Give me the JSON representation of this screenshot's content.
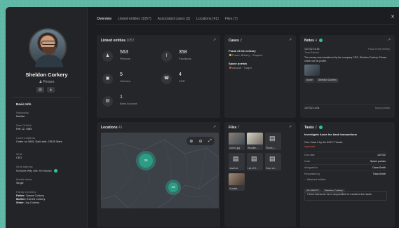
{
  "profile": {
    "name": "Sheldon Corkery",
    "type": "Person",
    "basic_info_title": "Basic Info",
    "fields": [
      {
        "k": "Nationality",
        "v": "Martian"
      },
      {
        "k": "Date Of Birth",
        "v": "Feb 12, 1985"
      },
      {
        "k": "Current address",
        "v": "Crater no 1840, Dark side, 29100 Mars"
      },
      {
        "k": "Work",
        "v": "CEO"
      },
      {
        "k": "Work Address",
        "v": "Kovacek Way 106, Tennessee"
      },
      {
        "k": "Marital status",
        "v": "Single"
      },
      {
        "k": "Family members",
        "v": ""
      }
    ],
    "family": [
      {
        "rel": "Father:",
        "name": "Tyrone Corkery"
      },
      {
        "rel": "Mother:",
        "name": "Everett Corkery"
      },
      {
        "rel": "Sister:",
        "name": "Joy Corkery"
      }
    ]
  },
  "tabs": [
    {
      "label": "Overview"
    },
    {
      "label": "Linked entities (1057)"
    },
    {
      "label": "Associated cases (2)"
    },
    {
      "label": "Locations (41)"
    },
    {
      "label": "Files (7)"
    }
  ],
  "linked": {
    "title": "Linked entities",
    "count": "1057",
    "stats": [
      {
        "num": "563",
        "label": "Persons",
        "icon": "person-icon",
        "glyph": "♟"
      },
      {
        "num": "358",
        "label": "Facebook",
        "icon": "facebook-icon",
        "glyph": "f"
      },
      {
        "num": "5",
        "label": "Vehicles",
        "icon": "car-icon",
        "glyph": "▣"
      },
      {
        "num": "4",
        "label": "CDR",
        "icon": "phone-icon",
        "glyph": "☎"
      },
      {
        "num": "1",
        "label": "Bank Account",
        "icon": "bank-icon",
        "glyph": "▤"
      }
    ]
  },
  "cases": {
    "title": "Cases",
    "count": "2",
    "items": [
      {
        "title": "Fraud of the century",
        "meta": "Fraud, Bribery · Suspect"
      },
      {
        "title": "Space portals",
        "meta": "Assault · Target"
      }
    ]
  },
  "notes": {
    "title": "Notes",
    "count": "4",
    "n1_date": "14/7/22 16:18",
    "n1_author": "Tiara Roberts",
    "n1_ref": "Fraud of the century",
    "n1_text": "The money was transferred by the company CEO, Sheldon Corkery. Please check out his profile.",
    "chips": [
      "Acme",
      "Sheldon Corkery"
    ],
    "n2_date": "14/7/22 14:04",
    "n2_ref": "Space portals"
  },
  "locations": {
    "title": "Locations",
    "count": "41",
    "clusters": [
      "28",
      "13"
    ]
  },
  "files": {
    "title": "Files",
    "count": "7",
    "items": [
      "zoom1.jpg",
      "Wooden...",
      "Phone_l...",
      "Josef.txt",
      "List of S...",
      "Gone de...",
      "Scrable..."
    ]
  },
  "tasks": {
    "title": "Tasks",
    "count": "2",
    "task_title": "Investigate Acme Inc bank transactions",
    "task_sub": "Can I have it by the EOD? Thanks",
    "priority": "Important",
    "rows": [
      {
        "k": "Due date",
        "v": "14/7/22"
      },
      {
        "k": "Case",
        "v": "Space portals"
      },
      {
        "k": "Assigned to",
        "v": "Dana Smith"
      },
      {
        "k": "Requested by",
        "v": "Tiara Smith"
      }
    ],
    "attached_label": "Attached entities",
    "chips": [
      "AB-98652T",
      "Sheldon Corkery"
    ],
    "footer": "I think that Acme Inc is responsible for transfers the hacks"
  },
  "colors": {
    "accent": "#2ec4a0",
    "suspect": "#f2c230",
    "target": "#e8554e"
  }
}
